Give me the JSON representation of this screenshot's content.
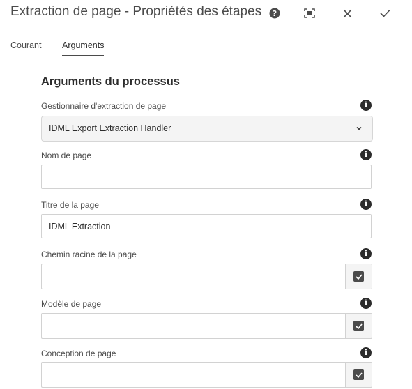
{
  "dialog": {
    "title": "Extraction de page - Propriétés des étapes",
    "toolbar_icons": [
      "help-icon",
      "fullscreen-icon",
      "close-icon",
      "check-icon"
    ]
  },
  "tabs": [
    {
      "label": "Courant",
      "active": false
    },
    {
      "label": "Arguments",
      "active": true
    }
  ],
  "section": {
    "title": "Arguments du processus"
  },
  "fields": {
    "handler": {
      "label": "Gestionnaire d'extraction de page",
      "value": "IDML Export Extraction Handler"
    },
    "page_name": {
      "label": "Nom de page",
      "value": ""
    },
    "page_title": {
      "label": "Titre de la page",
      "value": "IDML Extraction"
    },
    "root_path": {
      "label": "Chemin racine de la page",
      "value": ""
    },
    "page_template": {
      "label": "Modèle de page",
      "value": ""
    },
    "page_design": {
      "label": "Conception de page",
      "value": ""
    }
  },
  "info_glyph": "i",
  "colors": {
    "text": "#2c2c2c",
    "label": "#4b4b4b",
    "border": "#d2d2d2",
    "field_bg": "#f4f4f4"
  }
}
